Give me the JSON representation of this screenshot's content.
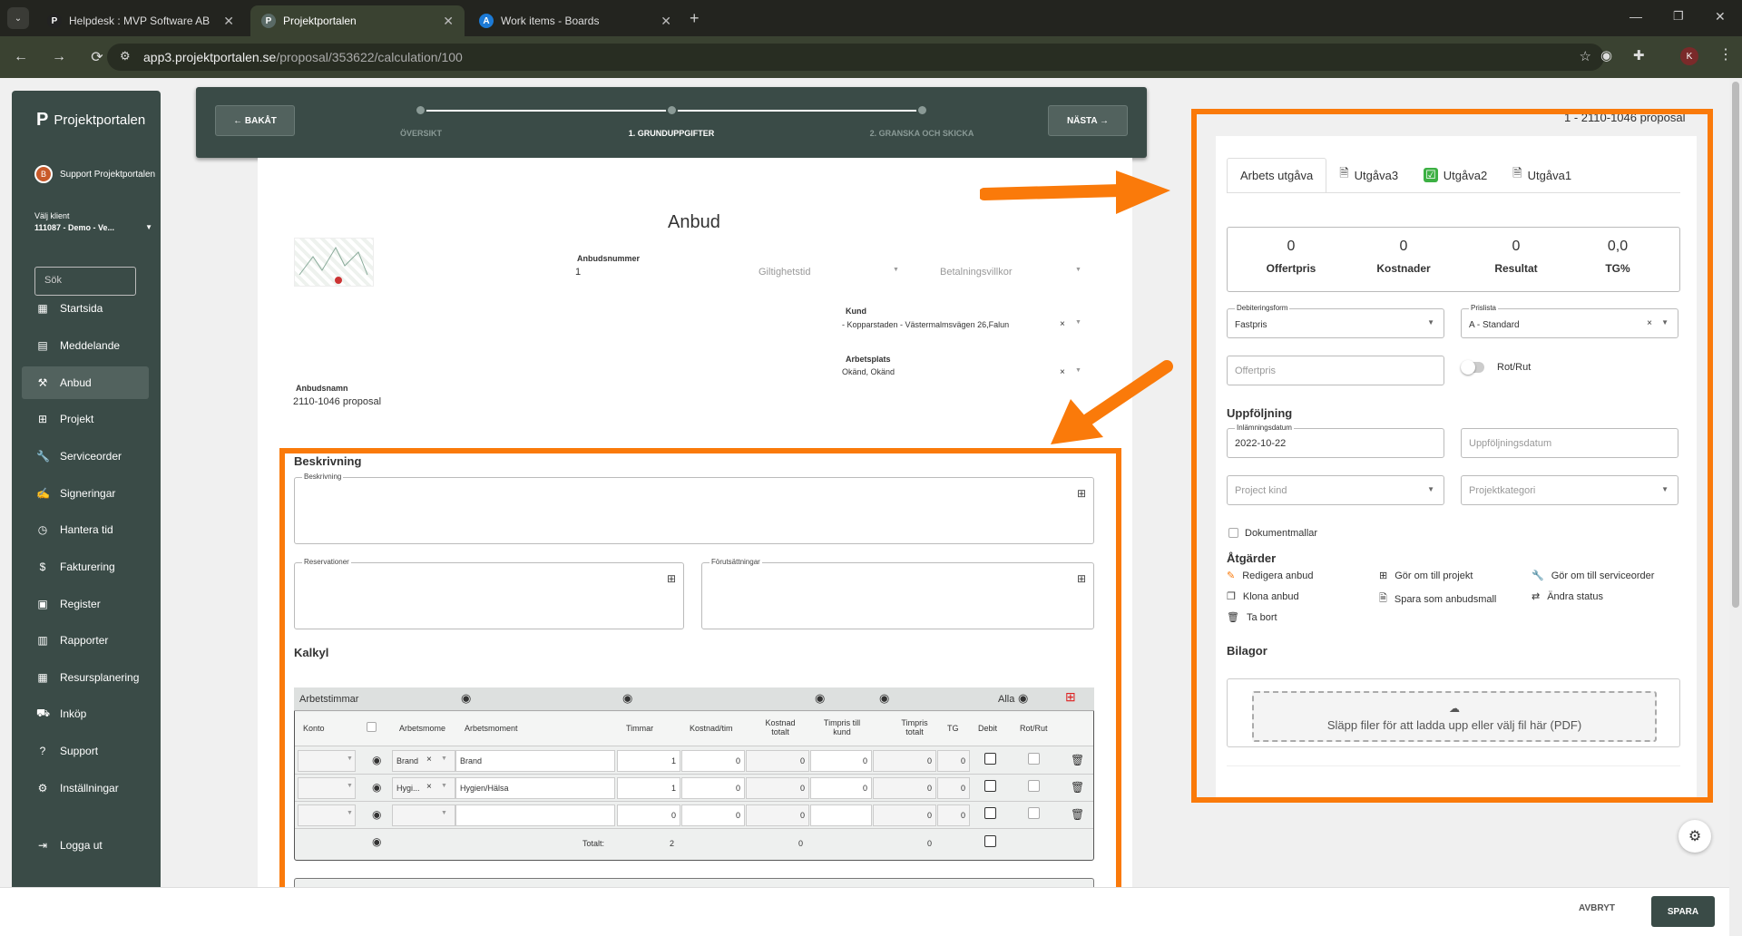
{
  "browser": {
    "tabs": [
      {
        "label": "Helpdesk : MVP Software AB",
        "icon": "P"
      },
      {
        "label": "Projektportalen",
        "icon": "P"
      },
      {
        "label": "Work items - Boards",
        "icon": "A"
      }
    ],
    "url_host": "app3.projektportalen.se",
    "url_path": "/proposal/353622/calculation/100",
    "avatar": "K"
  },
  "sidebar": {
    "brand": "Projektportalen",
    "user": "Support Projektportalen",
    "client_label": "Välj klient",
    "client_value": "111087 - Demo - Ve...",
    "search_placeholder": "Sök",
    "items": [
      {
        "label": "Startsida",
        "icon": "grid-icon"
      },
      {
        "label": "Meddelande",
        "icon": "message-icon"
      },
      {
        "label": "Anbud",
        "icon": "gavel-icon"
      },
      {
        "label": "Projekt",
        "icon": "project-icon"
      },
      {
        "label": "Serviceorder",
        "icon": "wrench-icon"
      },
      {
        "label": "Signeringar",
        "icon": "signature-icon"
      },
      {
        "label": "Hantera tid",
        "icon": "clock-icon"
      },
      {
        "label": "Fakturering",
        "icon": "dollar-icon"
      },
      {
        "label": "Register",
        "icon": "register-icon"
      },
      {
        "label": "Rapporter",
        "icon": "report-icon"
      },
      {
        "label": "Resursplanering",
        "icon": "calendar-icon"
      },
      {
        "label": "Inköp",
        "icon": "cart-icon"
      },
      {
        "label": "Support",
        "icon": "help-icon"
      },
      {
        "label": "Inställningar",
        "icon": "gear-icon"
      },
      {
        "label": "Logga ut",
        "icon": "logout-icon"
      }
    ]
  },
  "wizard": {
    "back": "← BAKÅT",
    "next": "NÄSTA →",
    "steps": [
      "ÖVERSIKT",
      "1. GRUNDUPPGIFTER",
      "2. GRANSKA OCH SKICKA"
    ]
  },
  "form": {
    "title": "Anbud",
    "anbudsnummer_label": "Anbudsnummer",
    "anbudsnummer": "1",
    "giltighetstid": "Giltighetstid",
    "betalningsvillkor": "Betalningsvillkor",
    "kund_label": "Kund",
    "kund": "- Kopparstaden - Västermalmsvägen 26,Falun",
    "arbetsplats_label": "Arbetsplats",
    "arbetsplats": "Okänd, Okänd",
    "anbudsnamn_label": "Anbudsnamn",
    "anbudsnamn": "2110-1046 proposal",
    "beskrivning_heading": "Beskrivning",
    "beskrivning_label": "Beskrivning",
    "reservationer_label": "Reservationer",
    "forutsattningar_label": "Förutsättningar",
    "kalkyl_heading": "Kalkyl"
  },
  "table": {
    "title": "Arbetstimmar",
    "alla": "Alla",
    "headers": [
      "Konto",
      "Arbetsmome",
      "Arbetsmoment",
      "Timmar",
      "Kostnad/tim",
      "Kostnad totalt",
      "Timpris till kund",
      "Timpris totalt",
      "TG",
      "Debit",
      "Rot/Rut"
    ],
    "rows": [
      {
        "tag": "Brand",
        "moment": "Brand",
        "timmar": "1",
        "kost_tim": "0",
        "kost_tot": "0",
        "timpris": "0",
        "timpris_tot": "0",
        "tg": "0"
      },
      {
        "tag": "Hygi...",
        "moment": "Hygien/Hälsa",
        "timmar": "1",
        "kost_tim": "0",
        "kost_tot": "0",
        "timpris": "0",
        "timpris_tot": "0",
        "tg": "0"
      },
      {
        "tag": "",
        "moment": "",
        "timmar": "0",
        "kost_tim": "0",
        "kost_tot": "0",
        "timpris": "",
        "timpris_tot": "0",
        "tg": "0"
      }
    ],
    "total_label": "Totalt:",
    "total_timmar": "2",
    "total_kost": "0",
    "total_timpris": "0"
  },
  "right": {
    "header_note": "1 - 2110-1046 proposal",
    "tabs": [
      "Arbets utgåva",
      "Utgåva3",
      "Utgåva2",
      "Utgåva1"
    ],
    "stats": [
      {
        "value": "0",
        "label": "Offertpris"
      },
      {
        "value": "0",
        "label": "Kostnader"
      },
      {
        "value": "0",
        "label": "Resultat"
      },
      {
        "value": "0,0",
        "label": "TG%"
      }
    ],
    "debitering_label": "Debiteringsform",
    "debitering": "Fastpris",
    "prislista_label": "Prislista",
    "prislista": "A - Standard",
    "offertpris_ph": "Offertpris",
    "rotrut": "Rot/Rut",
    "uppfoljning": "Uppföljning",
    "inlamning_label": "Inlämningsdatum",
    "inlamning": "2022-10-22",
    "uppfoljningsdatum_ph": "Uppföljningsdatum",
    "project_kind_ph": "Project kind",
    "projektkategori_ph": "Projektkategori",
    "dokumentmallar": "Dokumentmallar",
    "atgarder": "Åtgärder",
    "actions": [
      "Redigera anbud",
      "Gör om till projekt",
      "Gör om till serviceorder",
      "Klona anbud",
      "Spara som anbudsmall",
      "Ändra status",
      "Ta bort"
    ],
    "bilagor": "Bilagor",
    "drop_text": "Släpp filer för att ladda upp eller välj fil här (PDF)"
  },
  "footer": {
    "cancel": "AVBRYT",
    "save": "SPARA"
  },
  "colors": {
    "accent": "#fa7a0a",
    "brand": "#3a4b47"
  }
}
